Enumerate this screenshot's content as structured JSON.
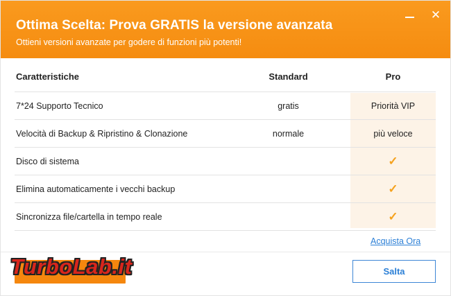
{
  "header": {
    "title": "Ottima Scelta: Prova GRATIS la versione avanzata",
    "subtitle": "Ottieni versioni avanzate per godere di funzioni più potenti!",
    "minimize_symbol": "—",
    "close_symbol": "✕"
  },
  "table": {
    "columns": [
      "Caratteristiche",
      "Standard",
      "Pro"
    ],
    "rows": [
      {
        "feature": "7*24 Supporto Tecnico",
        "standard": "gratis",
        "pro": "Priorità VIP"
      },
      {
        "feature": "Velocità di Backup & Ripristino & Clonazione",
        "standard": "normale",
        "pro": "più veloce"
      },
      {
        "feature": "Disco di sistema",
        "standard": "",
        "pro": "✓"
      },
      {
        "feature": "Elimina automaticamente i vecchi backup",
        "standard": "",
        "pro": "✓"
      },
      {
        "feature": "Sincronizza file/cartella in tempo reale",
        "standard": "",
        "pro": "✓"
      }
    ]
  },
  "footer": {
    "buy_link": "Acquista Ora",
    "skip_label": "Salta"
  },
  "watermark": "TurboLab.it",
  "colors": {
    "accent": "#f5870e",
    "link": "#2b7fd6",
    "pro_column": "#fdf3e7",
    "check": "#f5a21e"
  }
}
